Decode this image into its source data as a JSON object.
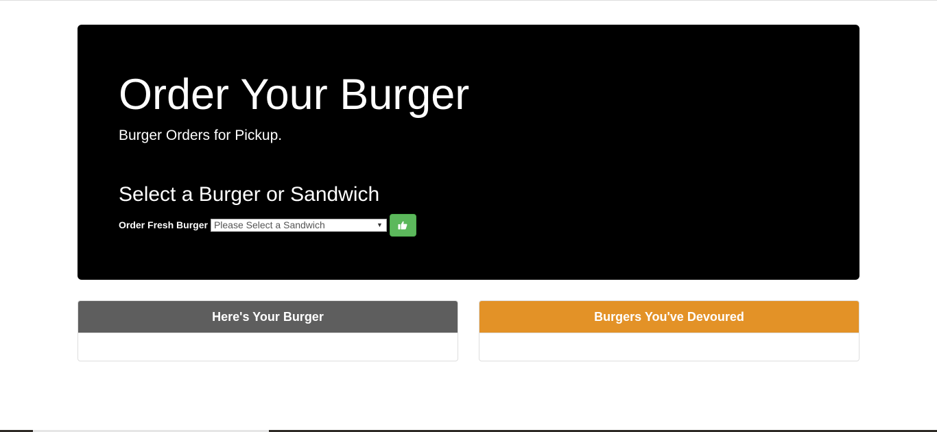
{
  "jumbotron": {
    "title": "Order Your Burger",
    "subtitle": "Burger Orders for Pickup.",
    "select_heading": "Select a Burger or Sandwich"
  },
  "order_form": {
    "label": "Order Fresh Burger",
    "select_value": "Please Select a Sandwich",
    "submit_icon": "thumbs-up-icon"
  },
  "panels": {
    "burger": {
      "title": "Here's Your Burger"
    },
    "devoured": {
      "title": "Burgers You've Devoured"
    }
  },
  "colors": {
    "jumbotron_bg": "#000000",
    "submit_button": "#5cb85c",
    "burger_panel_header": "#5e5e5e",
    "devoured_panel_header": "#e39227"
  }
}
